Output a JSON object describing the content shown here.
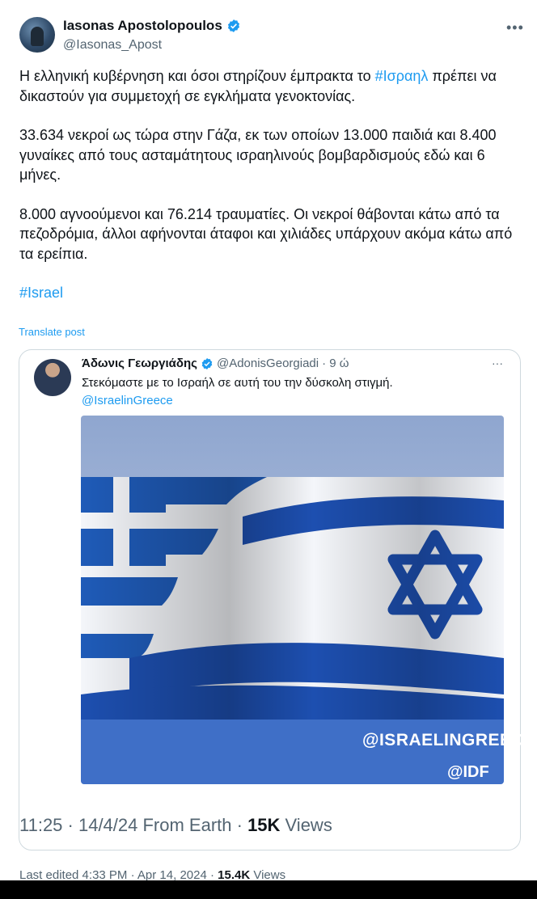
{
  "author": {
    "name": "Iasonas Apostolopoulos",
    "handle": "@Iasonas_Apost"
  },
  "more_label": "•••",
  "tweet": {
    "p1_before": "Η ελληνική κυβέρνηση και όσοι στηρίζουν έμπρακτα το ",
    "p1_hashtag": "#Ισραηλ",
    "p1_after": " πρέπει να δικαστούν για συμμετοχή σε εγκλήματα γενοκτονίας.",
    "p2": "33.634 νεκροί ως τώρα στην Γάζα, εκ των οποίων 13.000 παιδιά και 8.400 γυναίκες από τους ασταμάτητους ισραηλινούς βομβαρδισμούς εδώ και 6 μήνες.",
    "p3": "8.000 αγνοούμενοι και 76.214 τραυματίες. Οι νεκροί θάβονται κάτω από τα πεζοδρόμια, άλλοι αφήνονται άταφοι και χιλιάδες υπάρχουν ακόμα κάτω από τα ερείπια.",
    "hashtag": "#Israel"
  },
  "translate_label": "Translate post",
  "quoted": {
    "name": "Άδωνις Γεωργιάδης",
    "handle": "@AdonisGeorgiadi",
    "time": "· 9 ώ",
    "dots": "···",
    "text": "Στεκόμαστε με το Ισραήλ σε αυτή του την δύσκολη στιγμή.",
    "mention": "@IsraelinGreece",
    "watermark_1": "@ISRAELINGREECE",
    "watermark_2": "@IDF"
  },
  "meta": {
    "time": "11:25 · 14/4/24 From Earth · ",
    "views_count": "15K",
    "views_label": " Views"
  },
  "edited": {
    "text": "Last edited 4:33 PM · Apr 14, 2024 · ",
    "count": "15.4K",
    "label": " Views"
  },
  "colors": {
    "accent": "#1d9bf0",
    "flag_blue": "#1d4fb0",
    "text": "#0f1419",
    "secondary": "#536471"
  }
}
